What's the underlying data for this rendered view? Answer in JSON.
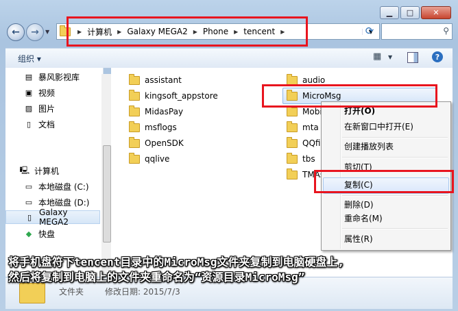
{
  "address": {
    "crumbs": [
      "计算机",
      "Galaxy MEGA2",
      "Phone",
      "tencent"
    ]
  },
  "toolbar": {
    "organize_label": "组织 ▾"
  },
  "nav": {
    "items": [
      {
        "label": "暴风影视库",
        "icon": "media-library-icon"
      },
      {
        "label": "视频",
        "icon": "video-icon"
      },
      {
        "label": "图片",
        "icon": "picture-icon"
      },
      {
        "label": "文档",
        "icon": "document-icon"
      },
      {
        "label": "计算机",
        "icon": "computer-icon"
      },
      {
        "label": "本地磁盘 (C:)",
        "icon": "drive-c-icon"
      },
      {
        "label": "本地磁盘 (D:)",
        "icon": "drive-d-icon"
      },
      {
        "label": "Galaxy MEGA2",
        "icon": "phone-icon"
      },
      {
        "label": "快盘",
        "icon": "kuaipan-icon"
      }
    ]
  },
  "files": {
    "left": [
      "assistant",
      "kingsoft_appstore",
      "MidasPay",
      "msflogs",
      "OpenSDK",
      "qqlive"
    ],
    "right": [
      "audio",
      "MicroMsg",
      "Mobi",
      "mta",
      "QQfil",
      "tbs",
      "TMAs"
    ]
  },
  "context_menu": {
    "open": "打开(O)",
    "open_new_window": "在新窗口中打开(E)",
    "create_playlist": "创建播放列表",
    "cut": "剪切(T)",
    "copy": "复制(C)",
    "delete": "删除(D)",
    "rename": "重命名(M)",
    "properties": "属性(R)"
  },
  "details": {
    "type": "文件夹",
    "date": "修改日期: 2015/7/3"
  },
  "instruction": {
    "line1": "将手机盘符下tencent目录中的MicroMsg文件夹复制到电脑硬盘上,",
    "line2": "然后将复制到电脑上的文件夹重命名为“资源目录MicroMsg”"
  },
  "colors": {
    "highlight_red": "#e8141e",
    "folder_yellow": "#f2cf57",
    "selection_blue": "#d5e5f9"
  }
}
